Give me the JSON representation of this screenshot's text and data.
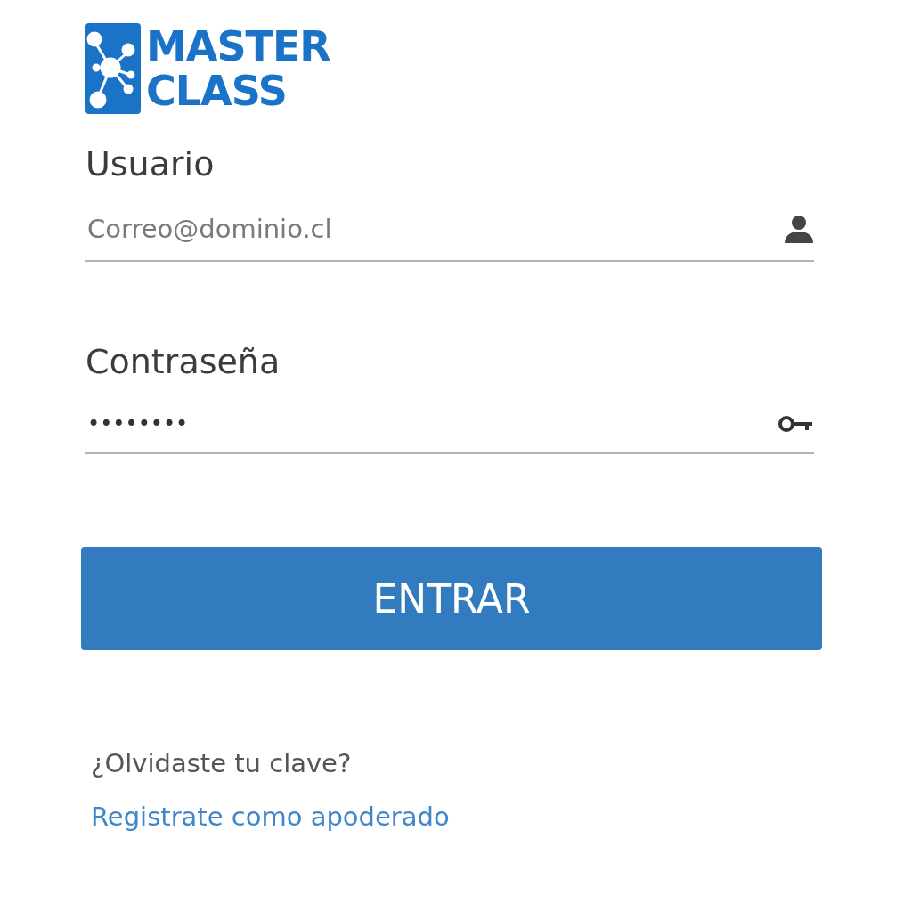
{
  "logo": {
    "lines": [
      "MASTER",
      "CLASS"
    ]
  },
  "fields": [
    {
      "label": "Usuario",
      "placeholder": "Correo@dominio.cl",
      "kind": "user"
    },
    {
      "label": "Contraseña",
      "value": "••••••••",
      "kind": "password"
    }
  ],
  "button": {
    "label": "ENTRAR"
  },
  "links": [
    {
      "label": "¿Olvidaste tu clave?",
      "kind": "plain"
    },
    {
      "label": "Registrate como apoderado",
      "kind": "link"
    }
  ]
}
